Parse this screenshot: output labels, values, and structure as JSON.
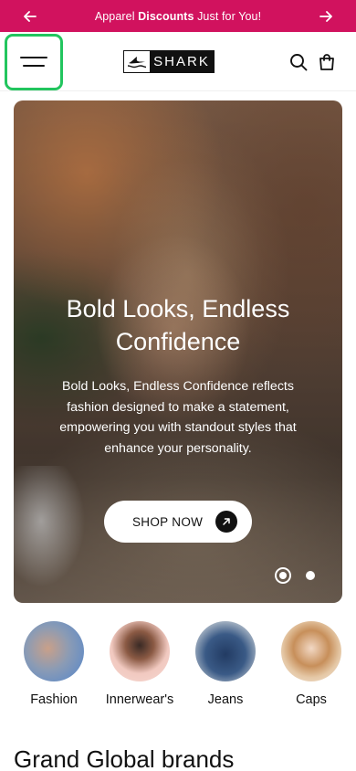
{
  "promo": {
    "text_before": "Apparel ",
    "text_bold": "Discounts",
    "text_after": " Just for You!",
    "prev_icon": "arrow-left-icon",
    "next_icon": "arrow-right-icon",
    "background": "#d1125e"
  },
  "header": {
    "menu_icon": "hamburger-menu-icon",
    "logo_text": "SHARK",
    "search_icon": "search-icon",
    "bag_icon": "shopping-bag-icon",
    "menu_highlight_color": "#22c55e"
  },
  "hero": {
    "title": "Bold Looks, Endless Confidence",
    "subtitle": "Bold Looks, Endless Confidence reflects fashion designed to make a statement, empowering you with standout styles that enhance your personality.",
    "cta_label": "SHOP NOW",
    "cta_icon": "arrow-up-right-icon",
    "slide_count": 2,
    "active_slide": 1
  },
  "categories": [
    {
      "label": "Fashion"
    },
    {
      "label": "Innerwear's"
    },
    {
      "label": "Jeans"
    },
    {
      "label": "Caps"
    }
  ],
  "brands_section": {
    "title": "Grand Global brands"
  }
}
